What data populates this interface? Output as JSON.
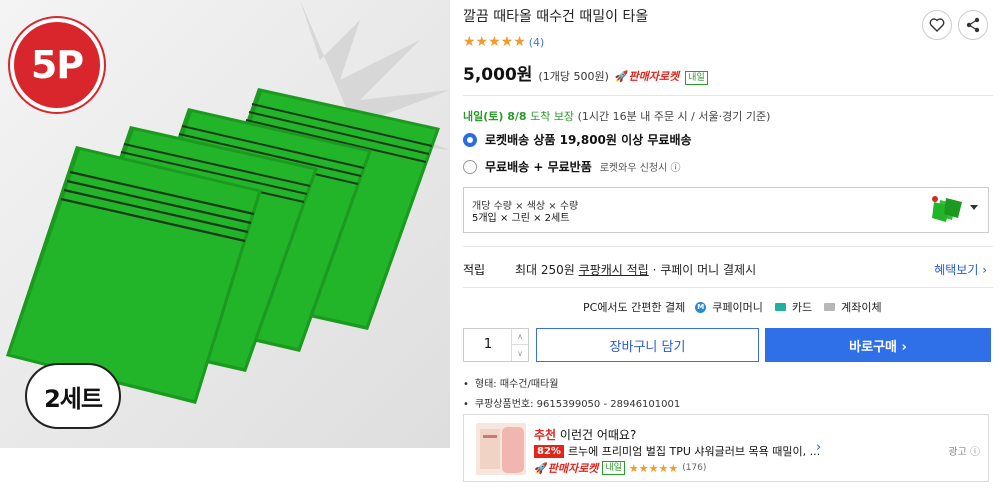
{
  "product": {
    "title": "깔끔 때타올 때수건 때밀이 타올",
    "stars": "★★★★★",
    "review_count": "(4)",
    "price": "5,000원",
    "unit_price": "(1개당 500원)",
    "rocket_label": "판매자로켓",
    "naeil_label": "내일"
  },
  "image_badges": {
    "count_badge": "5P",
    "set_badge": "2세트"
  },
  "delivery": {
    "day": "내일(토) 8/8",
    "arrive": "도착 보장",
    "note": "(1시간 16분 내 주문 시 / 서울·경기 기준)"
  },
  "shipping_options": [
    {
      "label": "로켓배송 상품 19,800원 이상 무료배송",
      "sub": "",
      "selected": true
    },
    {
      "label": "무료배송 + 무료반품",
      "sub": "로켓와우 신청시 ⓘ",
      "selected": false
    }
  ],
  "option": {
    "header": "개당 수량 × 색상 × 수량",
    "value": "5개입 × 그린 × 2세트"
  },
  "reward": {
    "label": "적립",
    "prefix": "최대 250원",
    "link": "쿠팡캐시 적립",
    "suffix": "· 쿠페이 머니 결제시",
    "more": "혜택보기 ›"
  },
  "payment": {
    "title": "PC에서도 간편한 결제",
    "coupay": "쿠페이머니",
    "card": "카드",
    "bank": "계좌이체"
  },
  "purchase": {
    "quantity": "1",
    "cart_label": "장바구니 담기",
    "buy_label": "바로구매 ›"
  },
  "specs": [
    {
      "text": "형태: 때수건/때타월"
    },
    {
      "text": "쿠팡상품번호: 9615399050 - 28946101001"
    }
  ],
  "recommend": {
    "title_red": "추천",
    "title_rest": " 이런건 어때요?",
    "discount": "82%",
    "name": "르누에 프리미엄 벌집 TPU 샤워글러브 목욕 때밀이, ...",
    "rocket_label": "판매자로켓",
    "naeil_label": "내일",
    "stars": "★★★★★",
    "count": "(176)",
    "ad_label": "광고 ⓘ"
  },
  "colors": {
    "accent_blue": "#2f6fe8",
    "rocket_red": "#e1251b",
    "delivery_green": "#2b9b2b",
    "product_green": "#22b52a",
    "star_orange": "#f29b2a"
  }
}
